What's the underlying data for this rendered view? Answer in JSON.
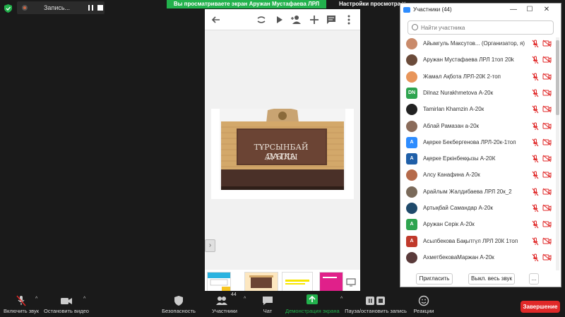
{
  "topbar": {
    "recording_label": "Запись...",
    "share_banner": "Вы просматриваете экран Аружан Мустафаева ЛРЛ 1топ 20k",
    "view_settings": "Настройки просмотра"
  },
  "slide": {
    "sign_line1": "ТҰРСЫНБАЙ ДАТҚА",
    "sign_line2": "АУЫЛЫ"
  },
  "participants": {
    "title": "Участники (44)",
    "search_placeholder": "Найти участника",
    "list": [
      {
        "name": "Айымгуль Максутов...  (Организатор, я)",
        "avatar": "photo",
        "color": "#c98a6a",
        "initials": ""
      },
      {
        "name": "Аружан Мустафаева ЛРЛ 1топ 20k",
        "avatar": "photo",
        "color": "#6b4b3a",
        "initials": ""
      },
      {
        "name": "Жамал Ақбота ЛРЛ-20К 2-топ",
        "avatar": "photo",
        "color": "#e8955a",
        "initials": ""
      },
      {
        "name": "Dilnaz Nurakhmetova А-20к",
        "avatar": "initials",
        "color": "#2ea44f",
        "initials": "DN"
      },
      {
        "name": "Tamirlan Khamzin А-20к",
        "avatar": "photo",
        "color": "#222222",
        "initials": ""
      },
      {
        "name": "Аблай Рамазан а-20к",
        "avatar": "photo",
        "color": "#8a6b5a",
        "initials": ""
      },
      {
        "name": "Ақерке Бекбергенова ЛРЛ-20к-1топ",
        "avatar": "initials",
        "color": "#2d8cff",
        "initials": "A"
      },
      {
        "name": "Ақерке Еркінбекқызы А-20К",
        "avatar": "initials",
        "color": "#1f5fa8",
        "initials": "A"
      },
      {
        "name": "Алсу Канафина А-20к",
        "avatar": "photo",
        "color": "#b56a4a",
        "initials": ""
      },
      {
        "name": "Арайлым Жалдибаева ЛРЛ 20к_2",
        "avatar": "photo",
        "color": "#7a6a5a",
        "initials": ""
      },
      {
        "name": "Артықбай Самандар А-20к",
        "avatar": "photo",
        "color": "#1f4a6b",
        "initials": ""
      },
      {
        "name": "Аружан Серік А-20к",
        "avatar": "initials",
        "color": "#2ea44f",
        "initials": "A"
      },
      {
        "name": "Асылбекова   Бақытгүл ЛРЛ 20К 1топ",
        "avatar": "initials",
        "color": "#c0392b",
        "initials": "A"
      },
      {
        "name": "АхметбековаМаржан А-20к",
        "avatar": "photo",
        "color": "#5a3a3a",
        "initials": ""
      }
    ],
    "invite_label": "Пригласить",
    "mute_all_label": "Выкл. весь звук",
    "more_label": "..."
  },
  "toolbar": {
    "unmute": "Включить звук",
    "stop_video": "Остановить видео",
    "security": "Безопасность",
    "participants": "Участники",
    "participants_count": "44",
    "chat": "Чат",
    "share_screen": "Демонстрация экрана",
    "pause_stop_recording": "Пауза/остановить запись",
    "reactions": "Реакции",
    "end": "Завершение"
  },
  "colors": {
    "green": "#22b14c",
    "end_red": "#e02828",
    "zoom_blue": "#2d8cff"
  }
}
